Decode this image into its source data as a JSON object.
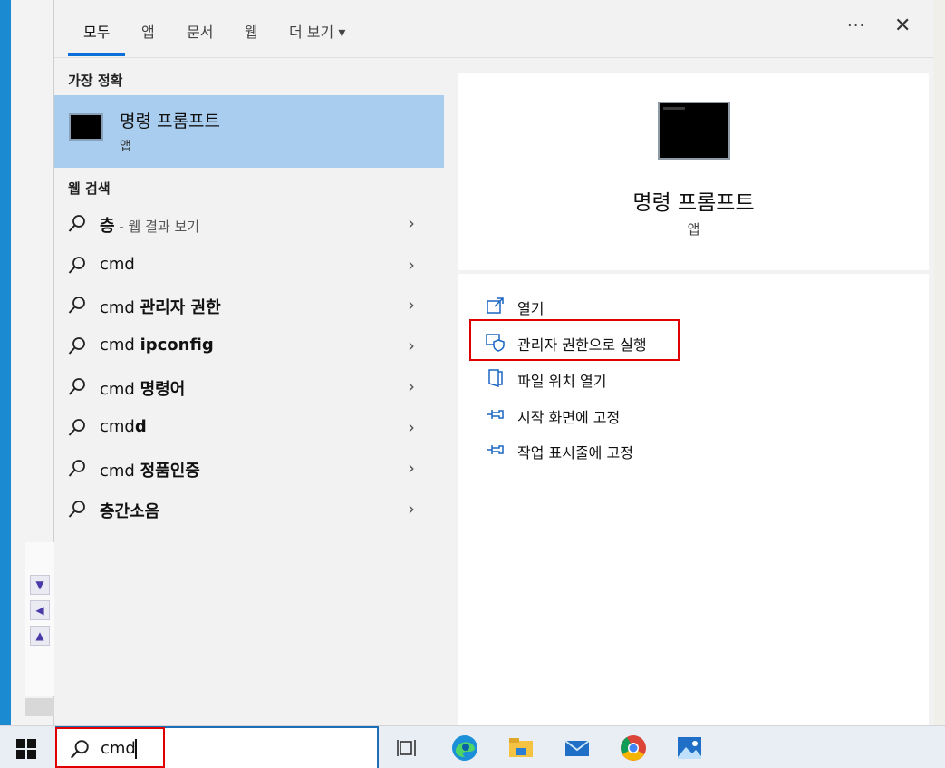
{
  "tabs": {
    "all": "모두",
    "apps": "앱",
    "documents": "문서",
    "web": "웹",
    "more": "더 보기 ▾"
  },
  "more_options": "···",
  "close": "✕",
  "best_match": {
    "section_label": "가장 정확",
    "title": "명령 프롬프트",
    "type": "앱"
  },
  "web_search": {
    "section_label": "웹 검색",
    "results": [
      {
        "bold": "층",
        "rest": "",
        "sub": " - 웹 결과 보기"
      },
      {
        "bold": "",
        "rest": "cmd",
        "sub": ""
      },
      {
        "prefix": "cmd ",
        "bold": "관리자 권한"
      },
      {
        "prefix": "cmd ",
        "bold": "ipconfig"
      },
      {
        "prefix": "cmd ",
        "bold": "명령어"
      },
      {
        "prefix": "cmd",
        "bold": "d"
      },
      {
        "prefix": "cmd ",
        "bold": "정품인증"
      },
      {
        "prefix": "",
        "bold": "층간소음"
      }
    ]
  },
  "detail": {
    "title": "명령 프롬프트",
    "type": "앱",
    "actions": {
      "open": "열기",
      "run_as_admin": "관리자 권한으로 실행",
      "open_file_location": "파일 위치 열기",
      "pin_to_start": "시작 화면에 고정",
      "pin_to_taskbar": "작업 표시줄에 고정"
    }
  },
  "taskbar": {
    "search_value": "cmd"
  },
  "colors": {
    "accent": "#0a6fd8",
    "selected": "#a9cdee",
    "highlight_border": "#e00000"
  }
}
